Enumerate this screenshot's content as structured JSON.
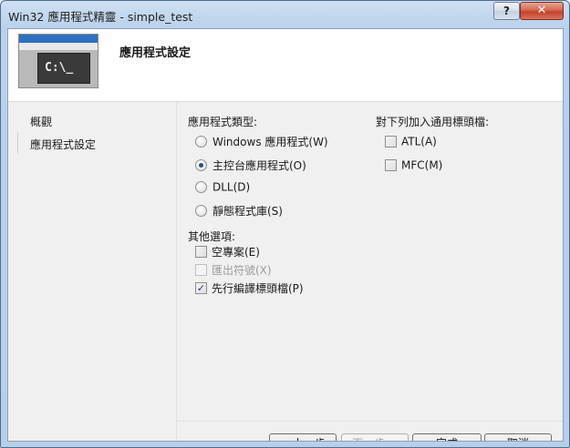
{
  "window": {
    "title": "Win32 應用程式精靈 - simple_test",
    "help_label": "?",
    "close_label": "✕"
  },
  "banner": {
    "title": "應用程式設定",
    "image_text": "C:\\_"
  },
  "nav": {
    "items": [
      {
        "label": "概觀"
      },
      {
        "label": "應用程式設定"
      }
    ]
  },
  "app_type": {
    "heading": "應用程式類型:",
    "options": [
      {
        "label": "Windows 應用程式(W)",
        "selected": false
      },
      {
        "label": "主控台應用程式(O)",
        "selected": true
      },
      {
        "label": "DLL(D)",
        "selected": false
      },
      {
        "label": "靜態程式庫(S)",
        "selected": false
      }
    ]
  },
  "other_options": {
    "heading": "其他選項:",
    "items": [
      {
        "label": "空專案(E)",
        "checked": false,
        "enabled": true
      },
      {
        "label": "匯出符號(X)",
        "checked": false,
        "enabled": false
      },
      {
        "label": "先行編譯標頭檔(P)",
        "checked": true,
        "enabled": true
      }
    ]
  },
  "headers": {
    "heading": "對下列加入通用標頭檔:",
    "items": [
      {
        "label": "ATL(A)",
        "checked": false
      },
      {
        "label": "MFC(M)",
        "checked": false
      }
    ]
  },
  "buttons": {
    "back": "< 上一步",
    "next": "下一步 >",
    "finish": "完成",
    "cancel": "取消"
  }
}
